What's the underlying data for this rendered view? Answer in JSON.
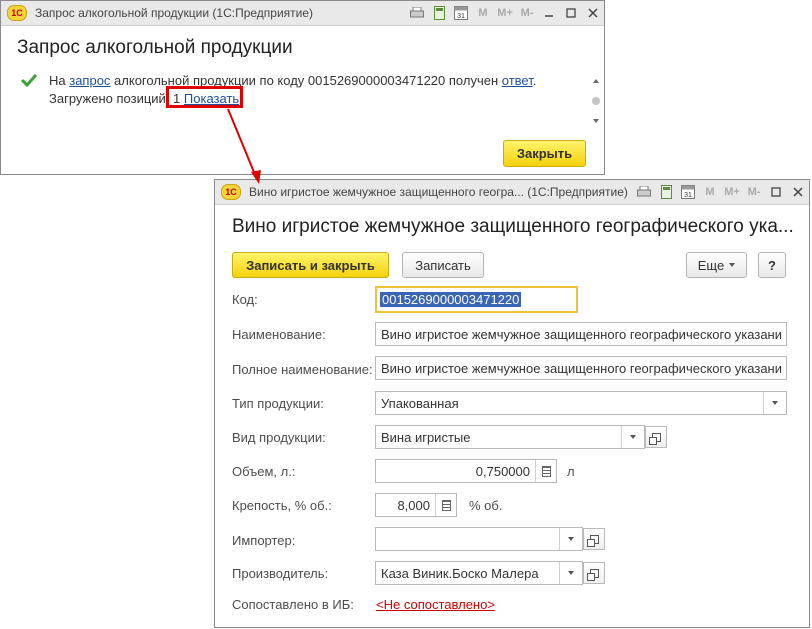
{
  "window1": {
    "title_bar": "Запрос алкогольной продукции  (1С:Предприятие)",
    "heading": "Запрос алкогольной продукции",
    "message": {
      "part1": "На ",
      "link1": "запрос",
      "part2": " алкогольной продукции по коду 0015269000003471220 получен ",
      "link2": "ответ",
      "part3": "."
    },
    "loaded_label": "Загружено позиций: 1",
    "show_link": "Показать",
    "close_button": "Закрыть",
    "toolbar": {
      "m": "M",
      "m_plus": "M+",
      "m_minus": "M-",
      "calendar_day": "31"
    }
  },
  "window2": {
    "title_bar": "Вино игристое жемчужное защищенного геогра...  (1С:Предприятие)",
    "heading": "Вино игристое жемчужное защищенного географического ука...",
    "save_close_button": "Записать и закрыть",
    "save_button": "Записать",
    "more_button": "Еще",
    "help_button": "?",
    "toolbar": {
      "m": "M",
      "m_plus": "M+",
      "m_minus": "M-",
      "calendar_day": "31"
    },
    "fields": {
      "code": {
        "label": "Код:",
        "value": "0015269000003471220"
      },
      "name": {
        "label": "Наименование:",
        "value": "Вино игристое жемчужное защищенного географического указани"
      },
      "full_name": {
        "label": "Полное наименование:",
        "value": "Вино игристое жемчужное защищенного географического указани"
      },
      "product_type": {
        "label": "Тип продукции:",
        "value": "Упакованная"
      },
      "product_kind": {
        "label": "Вид продукции:",
        "value": "Вина игристые"
      },
      "volume": {
        "label": "Объем, л.:",
        "value": "0,750000",
        "unit": "л"
      },
      "strength": {
        "label": "Крепость, % об.:",
        "value": "8,000",
        "unit": "% об."
      },
      "importer": {
        "label": "Импортер:",
        "value": ""
      },
      "producer": {
        "label": "Производитель:",
        "value": "Каза Виник.Боско Малера"
      },
      "matched": {
        "label": "Сопоставлено в ИБ:",
        "value": "<Не сопоставлено>"
      }
    }
  },
  "colors": {
    "highlight": "#e00000",
    "accent_yellow": "#f4d20c",
    "link": "#1d4f9a",
    "not_matched": "#cc0000"
  }
}
